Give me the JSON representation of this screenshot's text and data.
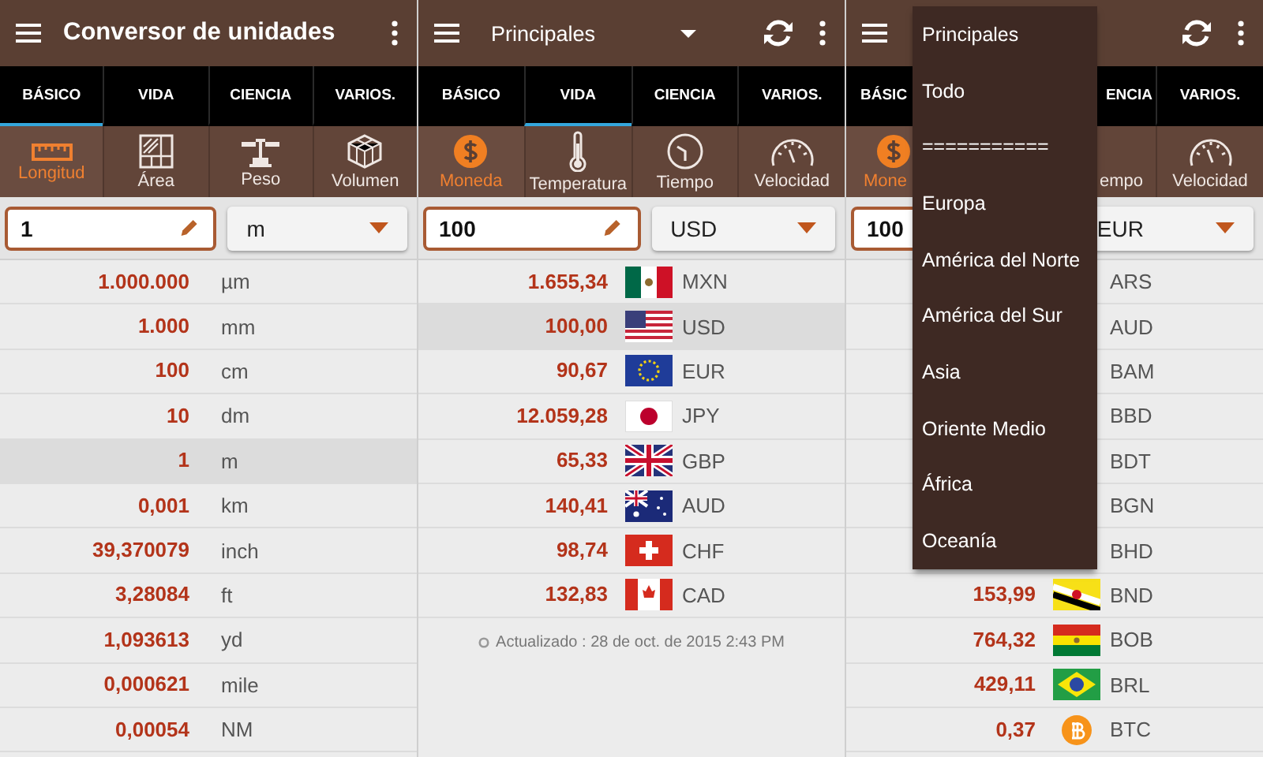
{
  "panels": [
    {
      "kind": "units",
      "toolbar": {
        "kind": "title",
        "title": "Conversor de unidades"
      },
      "tabs": [
        {
          "label": "BÁSICO",
          "selected": true
        },
        {
          "label": "VIDA",
          "selected": false
        },
        {
          "label": "CIENCIA",
          "selected": false
        },
        {
          "label": "VARIOS.",
          "selected": false
        }
      ],
      "categories": [
        {
          "label": "Longitud",
          "kind": "ruler",
          "selected": true
        },
        {
          "label": "Área",
          "kind": "grid",
          "selected": false
        },
        {
          "label": "Peso",
          "kind": "scale",
          "selected": false
        },
        {
          "label": "Volumen",
          "kind": "cube",
          "selected": false
        }
      ],
      "input": {
        "value": "1",
        "unit": "m"
      },
      "rows": [
        {
          "value": "1.000.000",
          "code": "µm",
          "selected": false
        },
        {
          "value": "1.000",
          "code": "mm",
          "selected": false
        },
        {
          "value": "100",
          "code": "cm",
          "selected": false
        },
        {
          "value": "10",
          "code": "dm",
          "selected": false
        },
        {
          "value": "1",
          "code": "m",
          "selected": true
        },
        {
          "value": "0,001",
          "code": "km",
          "selected": false
        },
        {
          "value": "39,370079",
          "code": "inch",
          "selected": false
        },
        {
          "value": "3,28084",
          "code": "ft",
          "selected": false
        },
        {
          "value": "1,093613",
          "code": "yd",
          "selected": false
        },
        {
          "value": "0,000621",
          "code": "mile",
          "selected": false
        },
        {
          "value": "0,00054",
          "code": "NM",
          "selected": false
        }
      ]
    },
    {
      "kind": "currency",
      "toolbar": {
        "kind": "spinner",
        "title": "Principales"
      },
      "tabs": [
        {
          "label": "BÁSICO",
          "selected": false
        },
        {
          "label": "VIDA",
          "selected": true
        },
        {
          "label": "CIENCIA",
          "selected": false
        },
        {
          "label": "VARIOS.",
          "selected": false
        }
      ],
      "categories": [
        {
          "label": "Moneda",
          "kind": "coin",
          "selected": true
        },
        {
          "label": "Temperatura",
          "kind": "thermometer",
          "selected": false
        },
        {
          "label": "Tiempo",
          "kind": "clock",
          "selected": false
        },
        {
          "label": "Velocidad",
          "kind": "gauge",
          "selected": false
        }
      ],
      "input": {
        "value": "100",
        "unit": "USD"
      },
      "rows": [
        {
          "value": "1.655,34",
          "kind": "mx",
          "code": "MXN",
          "selected": false
        },
        {
          "value": "100,00",
          "kind": "us",
          "code": "USD",
          "selected": true
        },
        {
          "value": "90,67",
          "kind": "eu",
          "code": "EUR",
          "selected": false
        },
        {
          "value": "12.059,28",
          "kind": "jp",
          "code": "JPY",
          "selected": false
        },
        {
          "value": "65,33",
          "kind": "gb",
          "code": "GBP",
          "selected": false
        },
        {
          "value": "140,41",
          "kind": "au",
          "code": "AUD",
          "selected": false
        },
        {
          "value": "98,74",
          "kind": "ch",
          "code": "CHF",
          "selected": false
        },
        {
          "value": "132,83",
          "kind": "ca",
          "code": "CAD",
          "selected": false
        }
      ],
      "footer": "Actualizado : 28 de oct. de 2015 2:43 PM"
    },
    {
      "kind": "currency",
      "toolbar": {
        "kind": "icons"
      },
      "tabs": [
        {
          "label": "BÁSIC",
          "selected": false
        },
        {
          "label": "ENCIA",
          "selected": false
        },
        {
          "label": "VARIOS.",
          "selected": false
        }
      ],
      "categories": [
        {
          "label": "Mone",
          "kind": "coin",
          "selected": true
        },
        {
          "label": "empo",
          "selected": false
        },
        {
          "label": "Velocidad",
          "kind": "gauge",
          "selected": false
        }
      ],
      "input": {
        "value": "100",
        "unit": "EUR"
      },
      "rows": [
        {
          "code": "ARS",
          "selected": false
        },
        {
          "code": "AUD",
          "selected": false
        },
        {
          "code": "BAM",
          "selected": false
        },
        {
          "code": "BBD",
          "selected": false
        },
        {
          "code": "BDT",
          "selected": false
        },
        {
          "code": "BGN",
          "selected": false
        },
        {
          "code": "BHD",
          "selected": false
        },
        {
          "value": "153,99",
          "kind": "bn",
          "code": "BND",
          "selected": false
        },
        {
          "value": "764,32",
          "kind": "bo",
          "code": "BOB",
          "selected": false
        },
        {
          "value": "429,11",
          "kind": "br",
          "code": "BRL",
          "selected": false
        },
        {
          "value": "0,37",
          "kind": "btc",
          "code": "BTC",
          "selected": false
        }
      ],
      "menu": [
        "Principales",
        "Todo",
        "===========",
        "Europa",
        "América del Norte",
        "América del Sur",
        "Asia",
        "Oriente Medio",
        "África",
        "Oceanía"
      ]
    }
  ]
}
